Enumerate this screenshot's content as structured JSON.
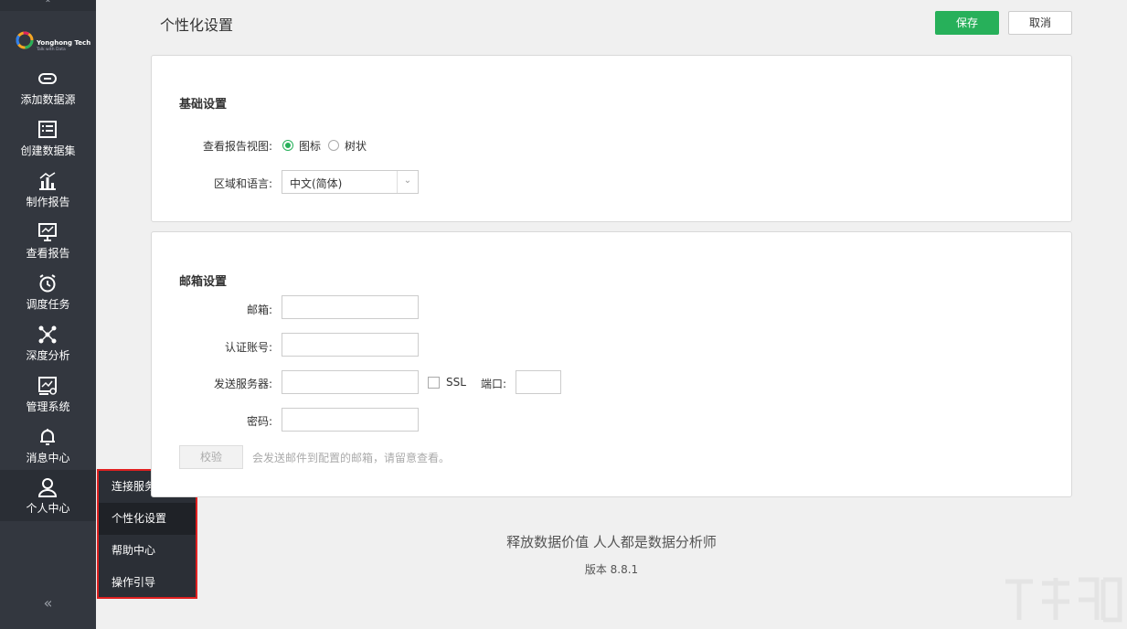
{
  "sidebar": {
    "logo": {
      "name": "Yonghong Tech",
      "tagline": "Talk with Data"
    },
    "items": [
      {
        "label": "添加数据源",
        "icon": "link-icon"
      },
      {
        "label": "创建数据集",
        "icon": "dataset-icon"
      },
      {
        "label": "制作报告",
        "icon": "chart-bar-icon"
      },
      {
        "label": "查看报告",
        "icon": "presentation-icon"
      },
      {
        "label": "调度任务",
        "icon": "alarm-clock-icon"
      },
      {
        "label": "深度分析",
        "icon": "network-nodes-icon"
      },
      {
        "label": "管理系统",
        "icon": "admin-gear-icon"
      },
      {
        "label": "消息中心",
        "icon": "bell-icon"
      },
      {
        "label": "个人中心",
        "icon": "user-icon"
      }
    ],
    "collapse_glyph": "«"
  },
  "submenu": {
    "items": [
      "连接服务器",
      "个性化设置",
      "帮助中心",
      "操作引导"
    ],
    "selected_index": 1
  },
  "header": {
    "title": "个性化设置",
    "save_label": "保存",
    "cancel_label": "取消"
  },
  "basic": {
    "title": "基础设置",
    "view_label": "查看报告视图:",
    "view_options": [
      "图标",
      "树状"
    ],
    "view_selected": "图标",
    "locale_label": "区域和语言:",
    "locale_value": "中文(简体)"
  },
  "mail": {
    "title": "邮箱设置",
    "email_label": "邮箱:",
    "email_value": "",
    "account_label": "认证账号:",
    "account_value": "",
    "server_label": "发送服务器:",
    "server_value": "",
    "ssl_label": "SSL",
    "ssl_checked": false,
    "port_label": "端口:",
    "port_value": "",
    "password_label": "密码:",
    "password_value": "",
    "verify_label": "校验",
    "hint": "会发送邮件到配置的邮箱，请留意查看。"
  },
  "footer": {
    "slogan": "释放数据价值 人人都是数据分析师",
    "version": "版本 8.8.1"
  },
  "colors": {
    "sidebar_bg": "#33373f",
    "accent_green": "#27b05a",
    "highlight_border": "#e02020"
  }
}
